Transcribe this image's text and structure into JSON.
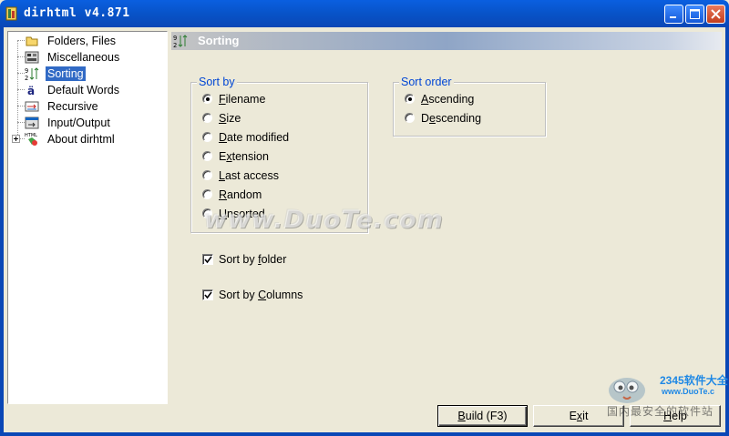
{
  "window": {
    "title": "dirhtml v4.871"
  },
  "tree": {
    "items": [
      {
        "label": "Folders, Files",
        "icon": "folder-icon"
      },
      {
        "label": "Miscellaneous",
        "icon": "misc-icon"
      },
      {
        "label": "Sorting",
        "icon": "sort-icon",
        "selected": true
      },
      {
        "label": "Default Words",
        "icon": "words-icon"
      },
      {
        "label": "Recursive",
        "icon": "recursive-icon"
      },
      {
        "label": "Input/Output",
        "icon": "io-icon"
      },
      {
        "label": "About dirhtml",
        "icon": "html-icon",
        "expandable": true
      }
    ]
  },
  "header": {
    "title": "Sorting"
  },
  "sort_by": {
    "legend": "Sort by",
    "options": [
      {
        "label": "Filename",
        "accel": "F",
        "selected": true
      },
      {
        "label": "Size",
        "accel": "S",
        "selected": false
      },
      {
        "label": "Date modified",
        "accel": "D",
        "selected": false
      },
      {
        "label": "Extension",
        "accel": "x",
        "selected": false
      },
      {
        "label": "Last access",
        "accel": "L",
        "selected": false
      },
      {
        "label": "Random",
        "accel": "R",
        "selected": false
      },
      {
        "label": "Unsorted",
        "accel": "U",
        "selected": false
      }
    ]
  },
  "sort_order": {
    "legend": "Sort order",
    "options": [
      {
        "label": "Ascending",
        "accel": "A",
        "selected": true
      },
      {
        "label": "Descending",
        "accel": "e",
        "selected": false
      }
    ]
  },
  "checkboxes": {
    "sort_by_folder": {
      "label": "Sort by folder",
      "checked": true
    },
    "sort_by_columns": {
      "label": "Sort by Columns",
      "checked": true
    }
  },
  "buttons": {
    "build": "Build (F3)",
    "exit": "Exit",
    "help": "Help"
  },
  "watermark": {
    "text": "www.DuoTe.com",
    "brand_title": "2345软件大全",
    "brand_url": "www.DuoTe.c",
    "brand_cn": "国内最安全的软件站"
  },
  "colors": {
    "titlebar": "#0A5FE0",
    "selection": "#316AC5",
    "group_legend": "#0046D5",
    "face": "#ECE9D8"
  }
}
